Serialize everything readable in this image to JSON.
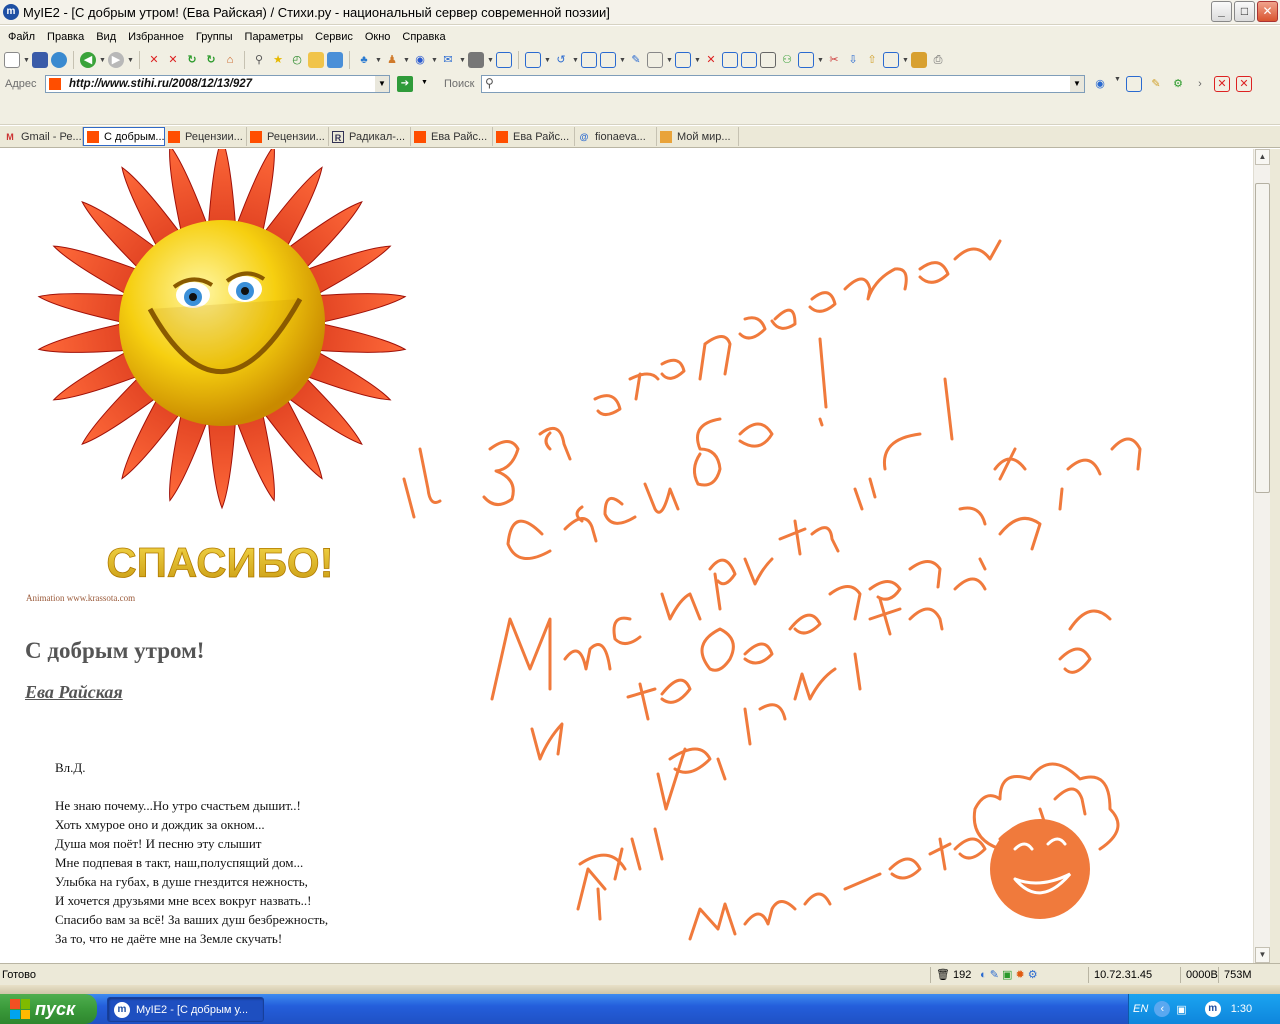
{
  "window": {
    "title": "MyIE2 - [С добрым утром! (Ева Райская) / Стихи.ру - национальный сервер современной поэзии]",
    "app_letter": "m",
    "minimize": "_",
    "maximize": "□",
    "close": "✕"
  },
  "menu": [
    "Файл",
    "Правка",
    "Вид",
    "Избранное",
    "Группы",
    "Параметры",
    "Сервис",
    "Окно",
    "Справка"
  ],
  "address": {
    "label": "Адрес",
    "url": "http://www.stihi.ru/2008/12/13/927"
  },
  "search": {
    "label": "Поиск"
  },
  "tabs": [
    {
      "label": "Gmail - Ре...",
      "icon": "gmail-icon"
    },
    {
      "label": "С добрым...",
      "icon": "stihi-icon"
    },
    {
      "label": "Рецензии...",
      "icon": "stihi-icon"
    },
    {
      "label": "Рецензии...",
      "icon": "stihi-icon"
    },
    {
      "label": "Радикал-...",
      "icon": "radikal-icon"
    },
    {
      "label": "Ева Райс...",
      "icon": "stihi-icon"
    },
    {
      "label": "Ева Райс...",
      "icon": "stihi-icon"
    },
    {
      "label": "fionaeva...",
      "icon": "at-icon"
    },
    {
      "label": "Мой мир...",
      "icon": "mymir-icon"
    }
  ],
  "page": {
    "image_caption": "СПАСИБО!",
    "credit": "Animation www.krassota.com",
    "heading": "С добрым утром!",
    "author": "Ева Райская",
    "dedication": "Вл.Д.",
    "poem_lines": [
      "Не знаю почему...Но утро счастьем дышит..!",
      "Хоть хмурое оно и дождик за окном...",
      "Душа моя поёт! И песню эту слышит",
      "Мне подпевая в такт, наш,полуспящий дом...",
      "Улыбка на губах, в душе гнездится нежность,",
      "И хочется друзьями мне всех вокруг назвать..!",
      "Спасибо вам за всё! За ваших душ безбрежность,",
      "За то, что не даёте мне на Земле скучать!"
    ],
    "handwriting_color": "#f07a3c"
  },
  "status": {
    "text": "Готово",
    "count": "192",
    "ip": "10.72.31.45",
    "traffic": "0000B",
    "memory": "753M"
  },
  "taskbar": {
    "start": "пуск",
    "item": "MyIE2 - [С добрым у...",
    "tray_lang": "EN",
    "clock": "1:30"
  }
}
